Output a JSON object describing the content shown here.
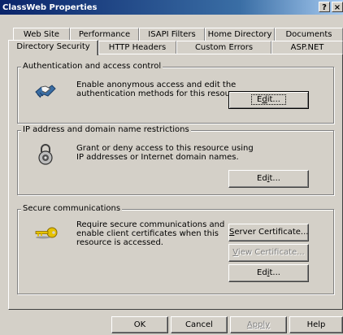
{
  "window": {
    "title": "ClassWeb Properties",
    "help_glyph": "?",
    "close_glyph": "×"
  },
  "tabs_row_back": [
    "Web Site",
    "Performance",
    "ISAPI Filters",
    "Home Directory",
    "Documents"
  ],
  "tabs_row_front": [
    "Directory Security",
    "HTTP Headers",
    "Custom Errors",
    "ASP.NET"
  ],
  "active_tab": "Directory Security",
  "auth": {
    "title": "Authentication and access control",
    "desc_line1": "Enable anonymous access and edit the",
    "desc_line2": "authentication methods for this resource.",
    "edit_pre": "E",
    "edit_u": "d",
    "edit_post": "it..."
  },
  "ip": {
    "title": "IP address and domain name restrictions",
    "desc_line1": "Grant or deny access to this resource using",
    "desc_line2": "IP addresses or Internet domain names.",
    "edit_pre": "Ed",
    "edit_u": "i",
    "edit_post": "t..."
  },
  "secure": {
    "title": "Secure communications",
    "desc_line1": "Require secure communications and",
    "desc_line2": "enable client certificates when this",
    "desc_line3": "resource is accessed.",
    "server_cert_u": "S",
    "server_cert_post": "erver Certificate...",
    "view_cert_u": "V",
    "view_cert_post": "iew Certificate...",
    "edit_pre": "Ed",
    "edit_u": "i",
    "edit_post": "t..."
  },
  "footer": {
    "ok": "OK",
    "cancel": "Cancel",
    "apply": "Apply",
    "help": "Help"
  }
}
